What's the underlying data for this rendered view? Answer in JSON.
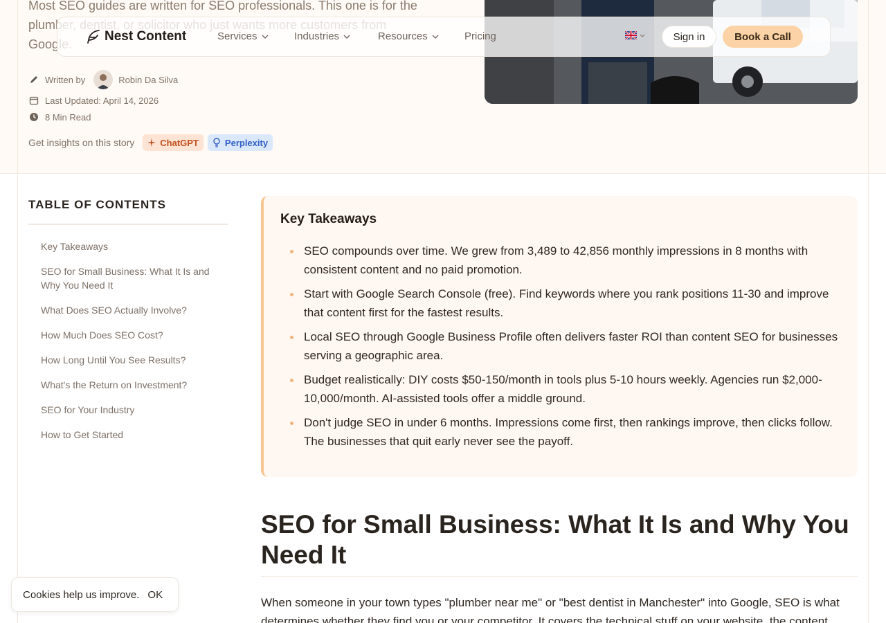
{
  "hero": {
    "intro": "Most SEO guides are written for SEO professionals. This one is for the plumber, dentist, or solicitor who just wants more customers from Google.",
    "written_by_label": "Written by",
    "author": "Robin Da Silva",
    "last_updated": "Last Updated: April 14, 2026",
    "read_time": "8 Min Read",
    "insights_label": "Get insights on this story",
    "chatgpt_label": "ChatGPT",
    "perplexity_label": "Perplexity"
  },
  "nav": {
    "brand": "Nest Content",
    "items": [
      {
        "label": "Services"
      },
      {
        "label": "Industries"
      },
      {
        "label": "Resources"
      },
      {
        "label": "Pricing"
      }
    ],
    "signin": "Sign in",
    "book_call": "Book a Call"
  },
  "toc": {
    "title": "TABLE OF CONTENTS",
    "items": [
      "Key Takeaways",
      "SEO for Small Business: What It Is and Why You Need It",
      "What Does SEO Actually Involve?",
      "How Much Does SEO Cost?",
      "How Long Until You See Results?",
      "What's the Return on Investment?",
      "SEO for Your Industry",
      "How to Get Started"
    ]
  },
  "takeaways": {
    "title": "Key Takeaways",
    "items": [
      "SEO compounds over time. We grew from 3,489 to 42,856 monthly impressions in 8 months with consistent content and no paid promotion.",
      "Start with Google Search Console (free). Find keywords where you rank positions 11-30 and improve that content first for the fastest results.",
      "Local SEO through Google Business Profile often delivers faster ROI than content SEO for businesses serving a geographic area.",
      "Budget realistically: DIY costs $50-150/month in tools plus 5-10 hours weekly. Agencies run $2,000-10,000/month. AI-assisted tools offer a middle ground.",
      "Don't judge SEO in under 6 months. Impressions come first, then rankings improve, then clicks follow. The businesses that quit early never see the payoff."
    ]
  },
  "article": {
    "heading": "SEO for Small Business: What It Is and Why You Need It",
    "paragraph": "When someone in your town types \"plumber near me\" or \"best dentist in Manchester\" into Google, SEO is what determines whether they find you or your competitor. It covers the technical stuff on your website, the content"
  },
  "cookie": {
    "text": "Cookies help us improve.",
    "ok": "OK"
  },
  "colors": {
    "accent": "#fbd3a6",
    "card_border": "#f7c592",
    "bullet": "#f2b37b"
  }
}
